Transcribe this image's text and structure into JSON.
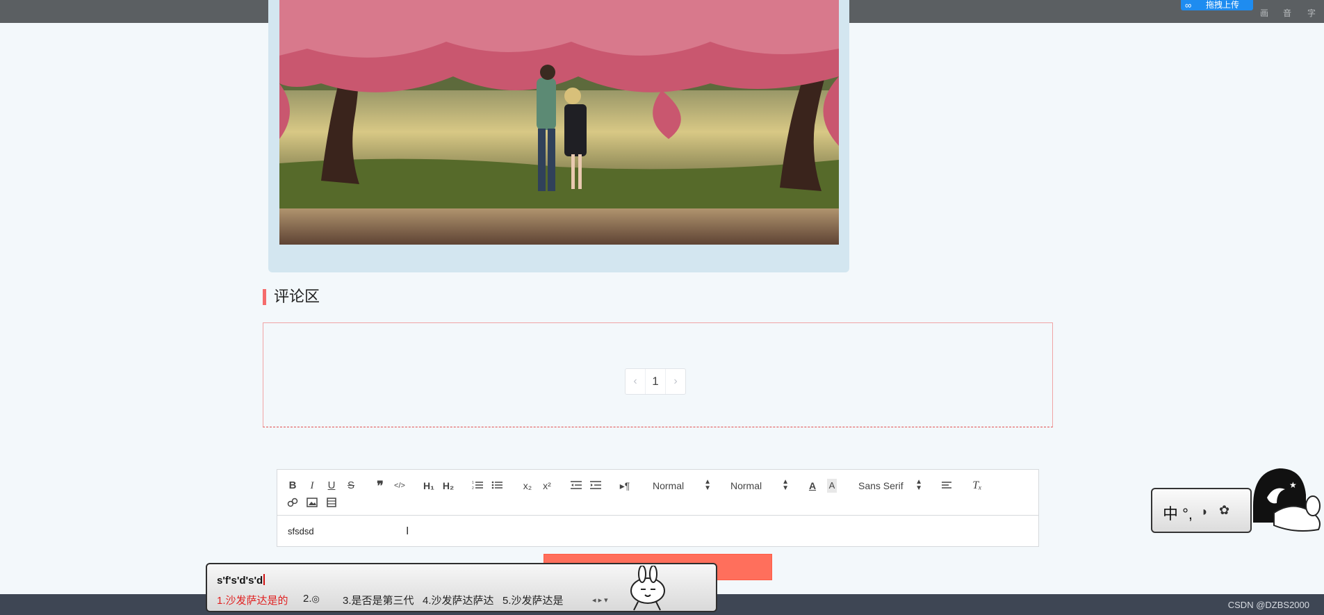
{
  "topbar": {
    "upload_label": "拖拽上传",
    "tools": [
      "画",
      "音",
      "字"
    ]
  },
  "comments": {
    "title": "评论区",
    "pager": {
      "prev": "‹",
      "page": "1",
      "next": "›"
    }
  },
  "editor": {
    "header_picker": "Normal",
    "size_picker": "Normal",
    "font_picker": "Sans Serif",
    "content": "sfsdsd"
  },
  "ime": {
    "composition": "s'f's'd's'd",
    "candidates": [
      "1.沙发萨达是的",
      "2.",
      "3.是否是第三代",
      "4.沙发萨达萨达",
      "5.沙发萨达是"
    ],
    "status_text": "中 °,"
  },
  "footer": {
    "credit": "CSDN @DZBS2000"
  },
  "colors": {
    "accent": "#f56c6c",
    "submit": "#ff6f5c",
    "footer_bg": "#3e4654"
  }
}
